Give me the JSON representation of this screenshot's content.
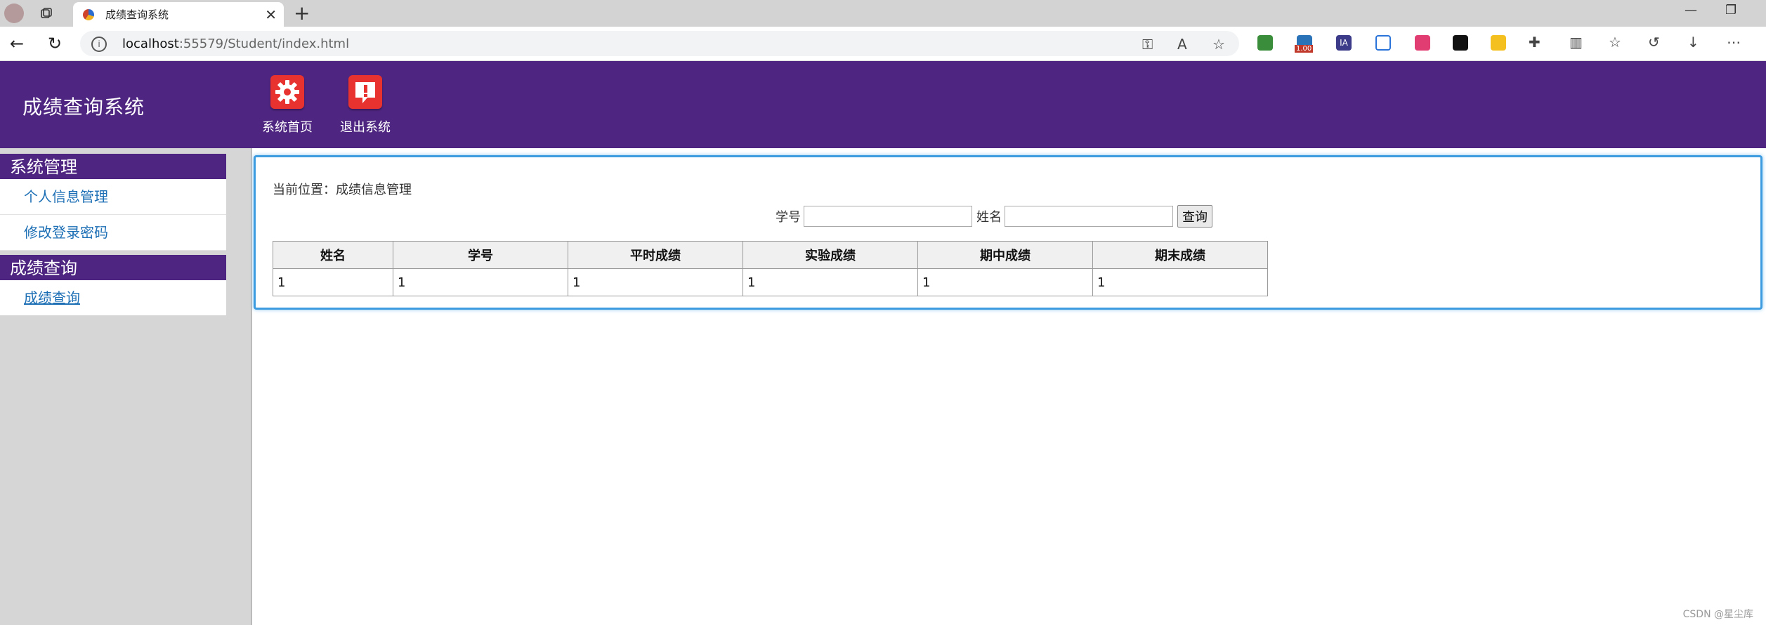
{
  "browser": {
    "tab_title": "成绩查询系统",
    "url_host": "localhost",
    "url_path": ":55579/Student/index.html",
    "extension_badge": "1.00"
  },
  "header": {
    "app_title": "成绩查询系统",
    "nav": [
      {
        "label": "系统首页",
        "icon": "gear-icon"
      },
      {
        "label": "退出系统",
        "icon": "alert-icon"
      }
    ]
  },
  "sidebar": {
    "groups": [
      {
        "title": "系统管理",
        "items": [
          "个人信息管理",
          "修改登录密码"
        ]
      },
      {
        "title": "成绩查询",
        "items": [
          "成绩查询"
        ]
      }
    ]
  },
  "main": {
    "breadcrumb": "当前位置：成绩信息管理",
    "search": {
      "student_id_label": "学号",
      "student_id_value": "",
      "name_label": "姓名",
      "name_value": "",
      "query_button": "查询"
    },
    "table": {
      "headers": [
        "姓名",
        "学号",
        "平时成绩",
        "实验成绩",
        "期中成绩",
        "期末成绩"
      ],
      "rows": [
        [
          "1",
          "1",
          "1",
          "1",
          "1",
          "1"
        ]
      ]
    }
  },
  "watermark": "CSDN @星尘库",
  "colors": {
    "header_bg": "#4e2580",
    "link": "#1d6fb5",
    "panel_border": "#3d9be0"
  }
}
